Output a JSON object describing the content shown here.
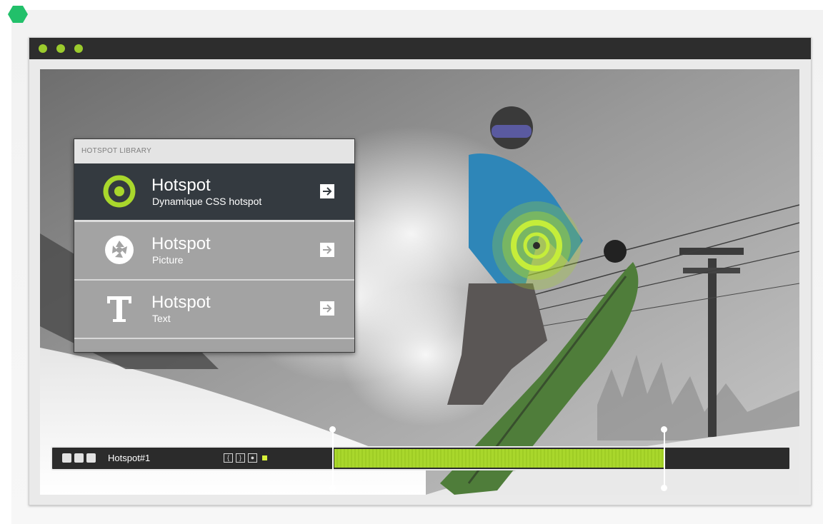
{
  "window": {
    "controls": [
      "close-dot",
      "minimize-dot",
      "maximize-dot"
    ],
    "dot_color": "#9bcb2d"
  },
  "library": {
    "header": "HOTSPOT LIBRARY",
    "items": [
      {
        "title": "Hotspot",
        "subtitle": "Dynamique CSS hotspot",
        "icon": "target-ring-icon",
        "active": true
      },
      {
        "title": "Hotspot",
        "subtitle": "Picture",
        "icon": "camera-aperture-icon",
        "active": false
      },
      {
        "title": "Hotspot",
        "subtitle": "Text",
        "icon": "text-t-icon",
        "active": false
      }
    ]
  },
  "timeline": {
    "layer_name": "Hotspot#1",
    "buttons": [
      "{",
      "}",
      "●"
    ],
    "accent": "#a9d72c"
  },
  "colors": {
    "accent": "#a9d72c",
    "titlebar": "#2d2d2d",
    "panel_active": "#343a40",
    "panel_item": "#a3a3a3"
  }
}
